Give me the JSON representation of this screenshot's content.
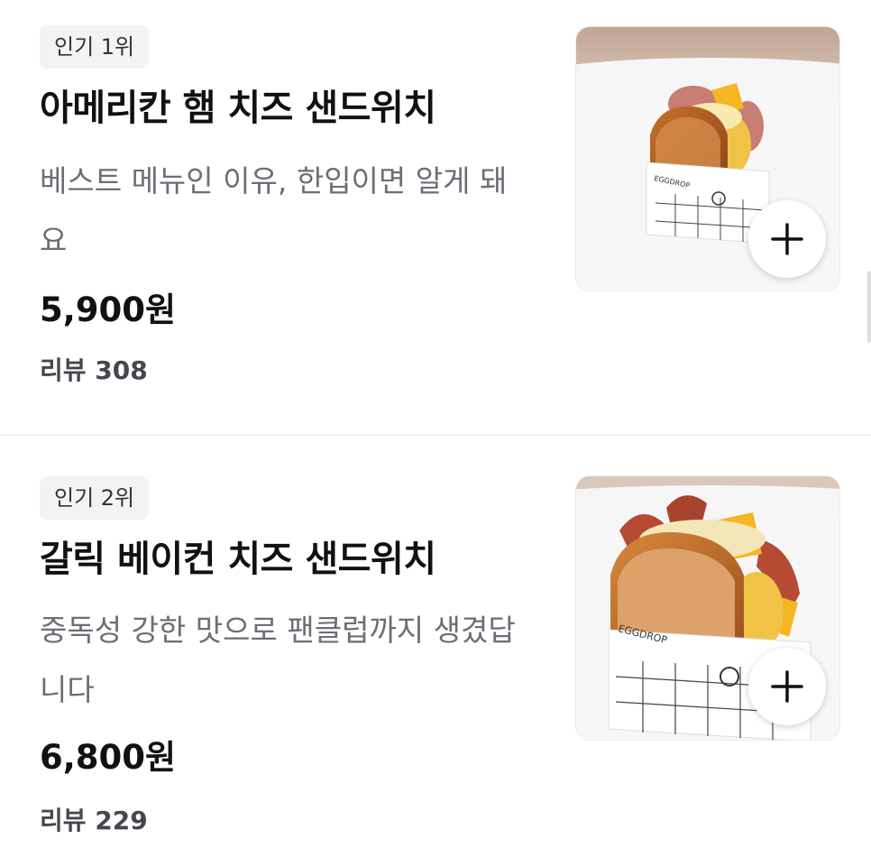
{
  "items": [
    {
      "badge": "인기 1위",
      "title": "아메리칸 햄 치즈 샌드위치",
      "description": "베스트 메뉴인 이유, 한입이면 알게 돼요",
      "price": "5,900원",
      "reviews": "리뷰 308",
      "image_alt": "아메리칸 햄 치즈 샌드위치",
      "box_label": "EGGDROP"
    },
    {
      "badge": "인기 2위",
      "title": "갈릭 베이컨 치즈 샌드위치",
      "description": "중독성 강한 맛으로 팬클럽까지 생겼답니다",
      "price": "6,800원",
      "reviews": "리뷰 229",
      "image_alt": "갈릭 베이컨 치즈 샌드위치",
      "box_label": "EGGDROP"
    }
  ],
  "icons": {
    "add": "plus-icon"
  },
  "colors": {
    "badge_bg": "#f2f3f5",
    "description": "#6b6e75",
    "divider": "#f1f1f3"
  }
}
